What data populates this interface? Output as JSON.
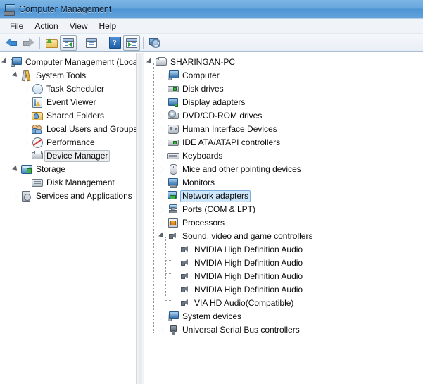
{
  "window": {
    "title": "Computer Management",
    "icon": "computer-management-icon"
  },
  "menubar": {
    "items": [
      {
        "label": "File"
      },
      {
        "label": "Action"
      },
      {
        "label": "View"
      },
      {
        "label": "Help"
      }
    ]
  },
  "toolbar": {
    "buttons": [
      {
        "name": "back-button",
        "icon": "back-arrow-icon",
        "enabled": true
      },
      {
        "name": "forward-button",
        "icon": "forward-arrow-icon",
        "enabled": false
      },
      {
        "name": "up-one-level-button",
        "icon": "folder-up-icon",
        "enabled": true
      },
      {
        "name": "show-hide-console-tree-button",
        "icon": "console-tree-icon",
        "enabled": true
      },
      {
        "name": "properties-button",
        "icon": "properties-window-icon",
        "enabled": true
      },
      {
        "name": "help-button",
        "icon": "help-question-icon",
        "enabled": true
      },
      {
        "name": "show-hide-action-pane-button",
        "icon": "action-pane-icon",
        "enabled": true
      },
      {
        "name": "scan-for-hardware-changes-button",
        "icon": "scan-hardware-icon",
        "enabled": true
      }
    ]
  },
  "left_tree": {
    "nodes": [
      {
        "label": "Computer Management (Local",
        "icon": "computer-management-icon",
        "twisty": "open",
        "level": 1,
        "selected": "none"
      },
      {
        "label": "System Tools",
        "icon": "system-tools-icon",
        "twisty": "open",
        "level": 2,
        "selected": "none"
      },
      {
        "label": "Task Scheduler",
        "icon": "task-scheduler-icon",
        "twisty": "closed",
        "level": 3,
        "selected": "none"
      },
      {
        "label": "Event Viewer",
        "icon": "event-viewer-icon",
        "twisty": "closed",
        "level": 3,
        "selected": "none"
      },
      {
        "label": "Shared Folders",
        "icon": "shared-folders-icon",
        "twisty": "closed",
        "level": 3,
        "selected": "none"
      },
      {
        "label": "Local Users and Groups",
        "icon": "local-users-groups-icon",
        "twisty": "closed",
        "level": 3,
        "selected": "none"
      },
      {
        "label": "Performance",
        "icon": "performance-icon",
        "twisty": "closed",
        "level": 3,
        "selected": "none"
      },
      {
        "label": "Device Manager",
        "icon": "device-manager-icon",
        "twisty": "none",
        "level": 3,
        "selected": "inactive"
      },
      {
        "label": "Storage",
        "icon": "storage-icon",
        "twisty": "open",
        "level": 2,
        "selected": "none"
      },
      {
        "label": "Disk Management",
        "icon": "disk-management-icon",
        "twisty": "none",
        "level": 3,
        "selected": "none"
      },
      {
        "label": "Services and Applications",
        "icon": "services-applications-icon",
        "twisty": "closed",
        "level": 2,
        "selected": "none"
      }
    ]
  },
  "right_tree": {
    "nodes": [
      {
        "label": "SHARINGAN-PC",
        "icon": "computer-root-icon",
        "twisty": "open",
        "level": 1,
        "selected": "none"
      },
      {
        "label": "Computer",
        "icon": "computer-icon",
        "twisty": "closed",
        "level": 2,
        "selected": "none"
      },
      {
        "label": "Disk drives",
        "icon": "disk-drive-icon",
        "twisty": "closed",
        "level": 2,
        "selected": "none"
      },
      {
        "label": "Display adapters",
        "icon": "display-adapter-icon",
        "twisty": "closed",
        "level": 2,
        "selected": "none"
      },
      {
        "label": "DVD/CD-ROM drives",
        "icon": "dvd-drive-icon",
        "twisty": "closed",
        "level": 2,
        "selected": "none"
      },
      {
        "label": "Human Interface Devices",
        "icon": "hid-icon",
        "twisty": "closed",
        "level": 2,
        "selected": "none"
      },
      {
        "label": "IDE ATA/ATAPI controllers",
        "icon": "ide-controller-icon",
        "twisty": "closed",
        "level": 2,
        "selected": "none"
      },
      {
        "label": "Keyboards",
        "icon": "keyboard-icon",
        "twisty": "closed",
        "level": 2,
        "selected": "none"
      },
      {
        "label": "Mice and other pointing devices",
        "icon": "mouse-icon",
        "twisty": "closed",
        "level": 2,
        "selected": "none"
      },
      {
        "label": "Monitors",
        "icon": "monitor-icon",
        "twisty": "closed",
        "level": 2,
        "selected": "none"
      },
      {
        "label": "Network adapters",
        "icon": "network-adapter-icon",
        "twisty": "closed",
        "level": 2,
        "selected": "active"
      },
      {
        "label": "Ports (COM & LPT)",
        "icon": "ports-icon",
        "twisty": "closed",
        "level": 2,
        "selected": "none"
      },
      {
        "label": "Processors",
        "icon": "processor-icon",
        "twisty": "closed",
        "level": 2,
        "selected": "none"
      },
      {
        "label": "Sound, video and game controllers",
        "icon": "sound-controller-icon",
        "twisty": "open",
        "level": 2,
        "selected": "none"
      },
      {
        "label": "NVIDIA High Definition Audio",
        "icon": "speaker-icon",
        "twisty": "none",
        "level": 3,
        "selected": "none"
      },
      {
        "label": "NVIDIA High Definition Audio",
        "icon": "speaker-icon",
        "twisty": "none",
        "level": 3,
        "selected": "none"
      },
      {
        "label": "NVIDIA High Definition Audio",
        "icon": "speaker-icon",
        "twisty": "none",
        "level": 3,
        "selected": "none"
      },
      {
        "label": "NVIDIA High Definition Audio",
        "icon": "speaker-icon",
        "twisty": "none",
        "level": 3,
        "selected": "none"
      },
      {
        "label": "VIA HD Audio(Compatible)",
        "icon": "speaker-icon",
        "twisty": "none",
        "level": 3,
        "selected": "none"
      },
      {
        "label": "System devices",
        "icon": "system-devices-icon",
        "twisty": "closed",
        "level": 2,
        "selected": "none"
      },
      {
        "label": "Universal Serial Bus controllers",
        "icon": "usb-controller-icon",
        "twisty": "closed",
        "level": 2,
        "selected": "none"
      }
    ]
  },
  "colors": {
    "titlebar_blue": "#6aa8dd",
    "selection_active": "#cfe7fb",
    "selection_active_border": "#7aaddb",
    "selection_inactive": "#eceef0",
    "selection_inactive_border": "#b6bbc1",
    "toolbar_bg": "#e8eef6",
    "menubar_bg": "#f0f4f9",
    "pane_bg": "#ffffff"
  }
}
